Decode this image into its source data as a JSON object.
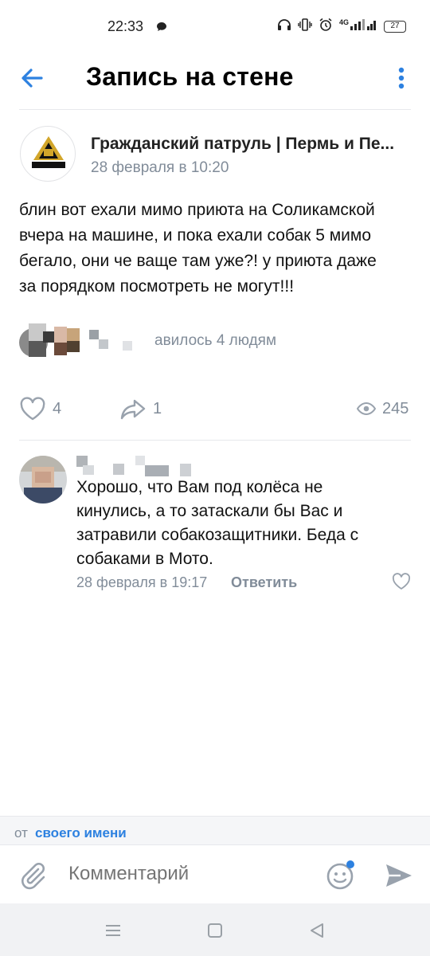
{
  "status_bar": {
    "time": "22:33",
    "network": "4G",
    "battery": "27",
    "icons": [
      "message-icon",
      "headphones-icon",
      "vibrate-icon",
      "alarm-icon",
      "signal-icon",
      "battery-icon"
    ]
  },
  "header": {
    "title": "Запись на стене",
    "back_icon": "arrow-left-icon",
    "more_icon": "more-vertical-icon"
  },
  "post": {
    "author": "Гражданский патруль | Пермь и Пе...",
    "date": "28 февраля в 10:20",
    "text_lines": [
      "блин вот ехали мимо приюта на Соликамской",
      "вчера на машине, и пока ехали собак 5 мимо",
      "бегало, они че ваще там уже?! у приюта даже",
      "за порядком посмотреть не могут!!!"
    ],
    "likes_text": "авилось 4 людям",
    "likes": "4",
    "shares": "1",
    "views": "245",
    "avatar_logo_text": "ПАТРУЛЬ"
  },
  "comment": {
    "text_lines": [
      "Хорошо, что Вам под колёса не",
      "кинулись, а то затаскали бы Вас и",
      "затравили собакозащитники. Беда с",
      "собаками в Мото."
    ],
    "date": "28 февраля в 19:17",
    "reply_label": "Ответить"
  },
  "composer": {
    "from_prefix": "от",
    "from_name": "своего имени",
    "placeholder": "Комментарий"
  },
  "colors": {
    "accent": "#2d81e0",
    "secondary_text": "#818c99",
    "separator": "#e7e8ec"
  }
}
